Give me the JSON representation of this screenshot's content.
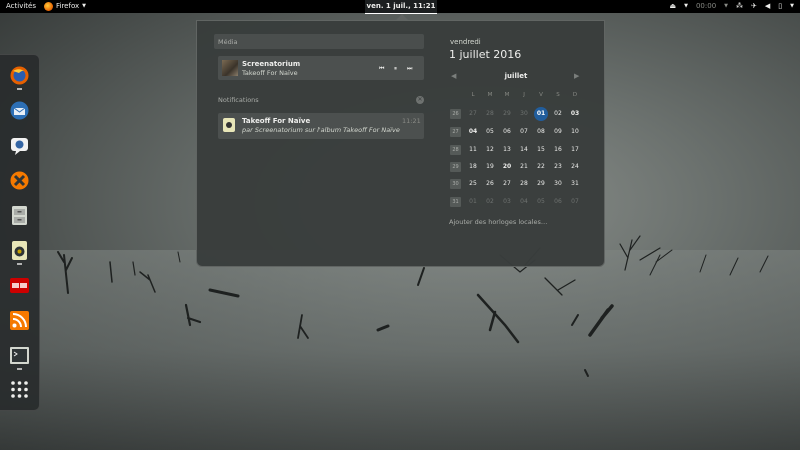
{
  "topbar": {
    "activities": "Activités",
    "app_name": "Firefox",
    "clock": "ven.  1 juil., 11:21",
    "status_time": "00:00"
  },
  "dash": {
    "apps": [
      "firefox-icon",
      "thunderbird-icon",
      "empathy-icon",
      "xchat-icon",
      "files-icon",
      "rhythmbox-icon",
      "software-center-icon",
      "rss-reader-icon",
      "terminal-icon",
      "show-applications-icon"
    ]
  },
  "media": {
    "section_title": "Média",
    "track_title": "Screenatorium",
    "track_subtitle": "Takeoff For Naïve",
    "controls": [
      "⏮",
      "⏸",
      "⏭"
    ]
  },
  "notifications": {
    "section_title": "Notifications",
    "clear_icon": "✕",
    "items": [
      {
        "title": "Takeoff For Naïve",
        "body": "par Screenatorium sur l'album Takeoff For Naïve",
        "time": "11:21"
      }
    ]
  },
  "calendar": {
    "weekday": "vendredi",
    "full_date": "1 juillet 2016",
    "month": "juillet",
    "prev": "◀",
    "next": "▶",
    "dow": [
      "L",
      "M",
      "M",
      "J",
      "V",
      "S",
      "D"
    ],
    "weeks": [
      "26",
      "27",
      "28",
      "29",
      "30",
      "31"
    ],
    "rows": [
      [
        {
          "d": "27",
          "m": "o"
        },
        {
          "d": "28",
          "m": "o"
        },
        {
          "d": "29",
          "m": "o"
        },
        {
          "d": "30",
          "m": "o"
        },
        {
          "d": "01",
          "m": "today"
        },
        {
          "d": "02",
          "m": "c"
        },
        {
          "d": "03",
          "m": "c",
          "b": true
        }
      ],
      [
        {
          "d": "04",
          "m": "c",
          "b": true
        },
        {
          "d": "05",
          "m": "c"
        },
        {
          "d": "06",
          "m": "c"
        },
        {
          "d": "07",
          "m": "c"
        },
        {
          "d": "08",
          "m": "c"
        },
        {
          "d": "09",
          "m": "c"
        },
        {
          "d": "10",
          "m": "c"
        }
      ],
      [
        {
          "d": "11",
          "m": "c"
        },
        {
          "d": "12",
          "m": "c"
        },
        {
          "d": "13",
          "m": "c"
        },
        {
          "d": "14",
          "m": "c"
        },
        {
          "d": "15",
          "m": "c"
        },
        {
          "d": "16",
          "m": "c"
        },
        {
          "d": "17",
          "m": "c"
        }
      ],
      [
        {
          "d": "18",
          "m": "c"
        },
        {
          "d": "19",
          "m": "c"
        },
        {
          "d": "20",
          "m": "c",
          "b": true
        },
        {
          "d": "21",
          "m": "c"
        },
        {
          "d": "22",
          "m": "c"
        },
        {
          "d": "23",
          "m": "c"
        },
        {
          "d": "24",
          "m": "c"
        }
      ],
      [
        {
          "d": "25",
          "m": "c"
        },
        {
          "d": "26",
          "m": "c"
        },
        {
          "d": "27",
          "m": "c"
        },
        {
          "d": "28",
          "m": "c"
        },
        {
          "d": "29",
          "m": "c"
        },
        {
          "d": "30",
          "m": "c"
        },
        {
          "d": "31",
          "m": "c"
        }
      ],
      [
        {
          "d": "01",
          "m": "o"
        },
        {
          "d": "02",
          "m": "o"
        },
        {
          "d": "03",
          "m": "o"
        },
        {
          "d": "04",
          "m": "o"
        },
        {
          "d": "05",
          "m": "o"
        },
        {
          "d": "06",
          "m": "o"
        },
        {
          "d": "07",
          "m": "o"
        }
      ]
    ],
    "add_clocks": "Ajouter des horloges locales…"
  },
  "colors": {
    "accent": "#215d9c",
    "panel": "#393d3c",
    "topbar": "#000000"
  }
}
